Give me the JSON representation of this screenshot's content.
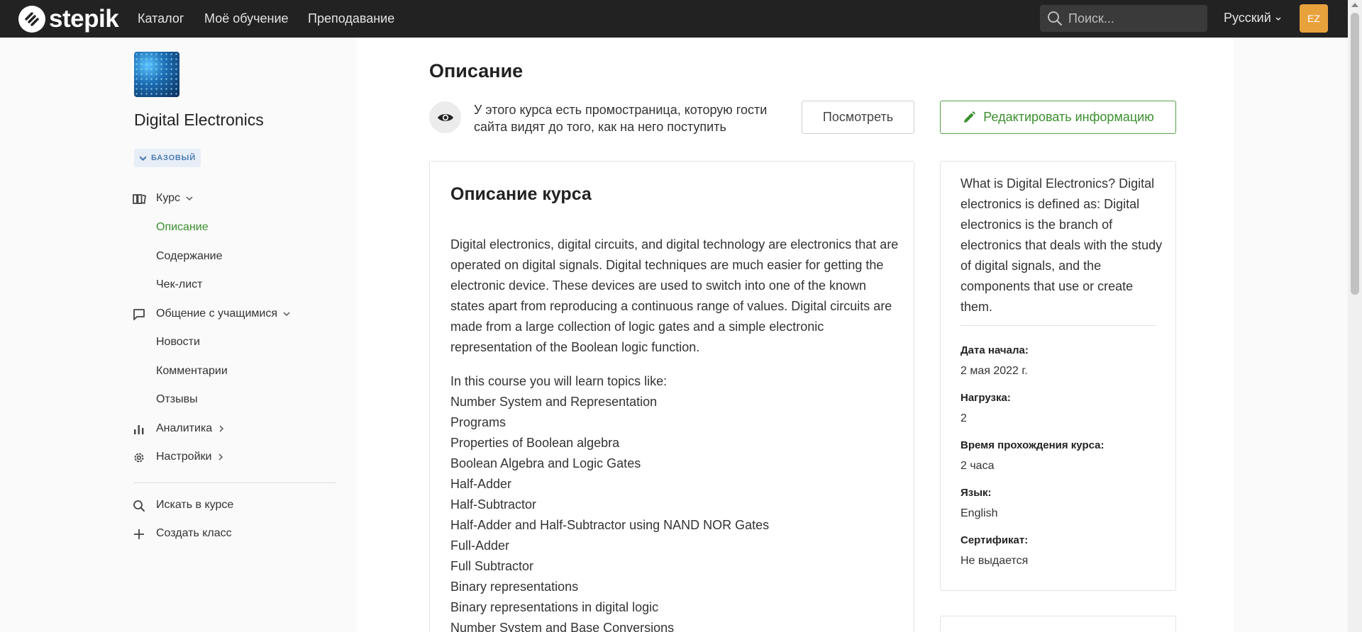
{
  "header": {
    "logo_text": "stepik",
    "nav": [
      "Каталог",
      "Моё обучение",
      "Преподавание"
    ],
    "search_placeholder": "Поиск...",
    "language": "Русский",
    "avatar_initials": "EZ",
    "colors": {
      "bar": "#222222",
      "avatar": "#e8a23c"
    }
  },
  "sidebar": {
    "course_title": "Digital Electronics",
    "level_badge": "БАЗОВЫЙ",
    "course_section": "Курс",
    "course_items": [
      "Описание",
      "Содержание",
      "Чек-лист"
    ],
    "active_item": "Описание",
    "community_section": "Общение с учащимися",
    "community_items": [
      "Новости",
      "Комментарии",
      "Отзывы"
    ],
    "analytics": "Аналитика",
    "settings": "Настройки",
    "search_course": "Искать в курсе",
    "create_class": "Создать класс",
    "colors": {
      "active": "#3b8f2e"
    }
  },
  "main": {
    "heading": "Описание",
    "promo_text": "У этого курса есть промостраница, которую гости сайта видят до того, как на него поступить",
    "view_button": "Посмотреть",
    "edit_button": "Редактировать информацию",
    "description": {
      "title": "Описание курса",
      "paragraph": "Digital electronics, digital circuits, and digital technology are electronics that are operated on digital signals. Digital techniques are much easier for getting the electronic device. These devices are used to switch into one of the known states apart from reproducing a continuous range of values. Digital circuits are made from a large collection of logic gates and a simple electronic representation of the Boolean logic function.",
      "topics_intro": "In this course you will learn topics like:",
      "topics": [
        "Number System and Representation",
        "Programs",
        "Properties of Boolean algebra",
        "Boolean Algebra and Logic Gates",
        "Half-Adder",
        "Half-Subtractor",
        "Half-Adder and Half-Subtractor using NAND NOR Gates",
        "Full-Adder",
        "Full Subtractor",
        "Binary representations",
        "Binary representations in digital logic",
        "Number System and Base Conversions"
      ]
    },
    "info": {
      "summary": "What is Digital Electronics? Digital electronics is defined as: Digital electronics is the branch of electronics that deals with the study of digital signals, and the components that use or create them.",
      "start_label": "Дата начала:",
      "start_value": "2 мая 2022 г.",
      "load_label": "Нагрузка:",
      "load_value": "2",
      "duration_label": "Время прохождения курса:",
      "duration_value": "2 часа",
      "language_label": "Язык:",
      "language_value": "English",
      "certificate_label": "Сертификат:",
      "certificate_value": "Не выдается"
    }
  }
}
